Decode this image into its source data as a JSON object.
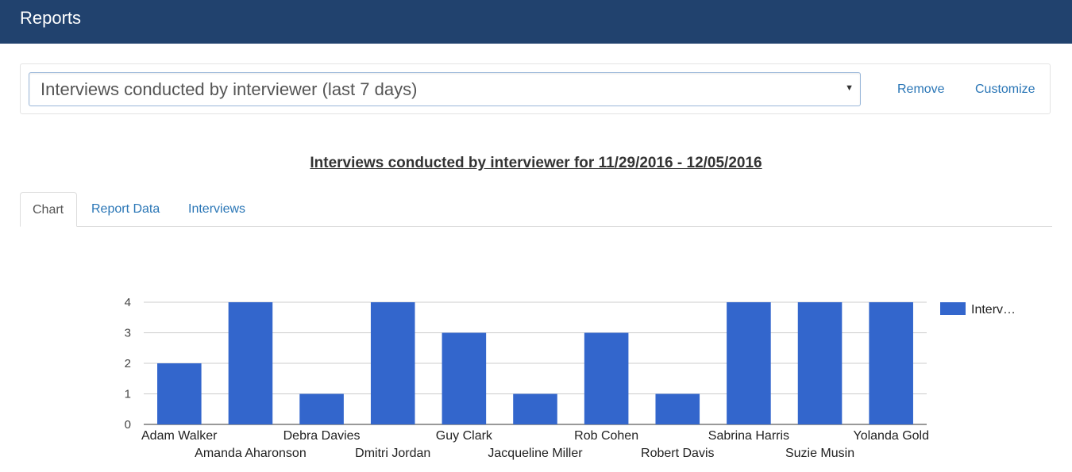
{
  "app": {
    "title": "Reports"
  },
  "report_selector": {
    "selected": "Interviews conducted by interviewer (last 7 days)",
    "caret_icon": "caret-down-icon"
  },
  "actions": {
    "remove_label": "Remove",
    "customize_label": "Customize"
  },
  "report_title": "Interviews conducted by interviewer for 11/29/2016 - 12/05/2016",
  "tabs": [
    {
      "label": "Chart",
      "active": true
    },
    {
      "label": "Report Data",
      "active": false
    },
    {
      "label": "Interviews",
      "active": false
    }
  ],
  "colors": {
    "header_bg": "#21426e",
    "link": "#2a76b6",
    "bar": "#3366cc"
  },
  "chart_data": {
    "type": "bar",
    "categories": [
      "Adam Walker",
      "Amanda Aharonson",
      "Debra Davies",
      "Dmitri Jordan",
      "Guy Clark",
      "Jacqueline Miller",
      "Rob Cohen",
      "Robert Davis",
      "Sabrina Harris",
      "Suzie Musin",
      "Yolanda Gold"
    ],
    "series": [
      {
        "name": "Interv…",
        "values": [
          2,
          4,
          1,
          4,
          3,
          1,
          3,
          1,
          4,
          4,
          4
        ]
      }
    ],
    "yticks": [
      "0",
      "1",
      "2",
      "3",
      "4"
    ],
    "ylim": [
      0,
      4
    ],
    "grid": true,
    "legend_position": "right"
  }
}
